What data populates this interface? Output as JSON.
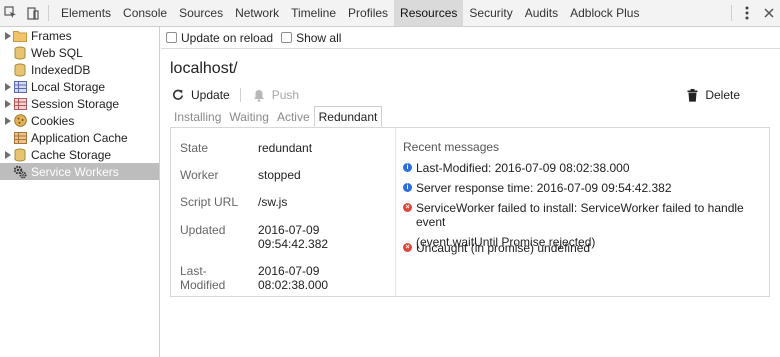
{
  "toolbar": {
    "tabs": [
      {
        "label": "Elements"
      },
      {
        "label": "Console"
      },
      {
        "label": "Sources"
      },
      {
        "label": "Network"
      },
      {
        "label": "Timeline"
      },
      {
        "label": "Profiles"
      },
      {
        "label": "Resources",
        "active": true
      },
      {
        "label": "Security"
      },
      {
        "label": "Audits"
      },
      {
        "label": "Adblock Plus"
      }
    ],
    "icons": [
      "inspect-cursor-icon",
      "device-mode-icon",
      "more-vertical-icon",
      "close-icon"
    ]
  },
  "sidebar": {
    "items": [
      {
        "label": "Frames",
        "icon": "folder-icon",
        "expandable": true
      },
      {
        "label": "Web SQL",
        "icon": "database-icon",
        "expandable": false
      },
      {
        "label": "IndexedDB",
        "icon": "database-icon",
        "expandable": false
      },
      {
        "label": "Local Storage",
        "icon": "table-icon",
        "expandable": true
      },
      {
        "label": "Session Storage",
        "icon": "table-icon",
        "expandable": true
      },
      {
        "label": "Cookies",
        "icon": "cookie-icon",
        "expandable": true
      },
      {
        "label": "Application Cache",
        "icon": "table-icon",
        "expandable": false
      },
      {
        "label": "Cache Storage",
        "icon": "database-icon",
        "expandable": true
      },
      {
        "label": "Service Workers",
        "icon": "gears-icon",
        "expandable": false,
        "selected": true
      }
    ]
  },
  "options": {
    "update_on_reload": "Update on reload",
    "show_all": "Show all"
  },
  "host": "localhost/",
  "actions": {
    "update": "Update",
    "push": "Push",
    "delete": "Delete"
  },
  "state_tabs": [
    {
      "label": "Installing"
    },
    {
      "label": "Waiting"
    },
    {
      "label": "Active"
    },
    {
      "label": "Redundant",
      "active": true
    }
  ],
  "fields": [
    {
      "key": "State",
      "value": "redundant"
    },
    {
      "key": "Worker",
      "value": "stopped"
    },
    {
      "key": "Script URL",
      "value": "/sw.js"
    },
    {
      "key": "Updated",
      "value": "2016-07-09",
      "value2": "09:54:42.382"
    },
    {
      "key": "Last-",
      "key2": "Modified",
      "value": "2016-07-09",
      "value2": "08:02:38.000"
    }
  ],
  "messages": {
    "title": "Recent messages",
    "items": [
      {
        "level": "info",
        "text": "Last-Modified: 2016-07-09 08:02:38.000"
      },
      {
        "level": "info",
        "text": "Server response time: 2016-07-09 09:54:42.382"
      },
      {
        "level": "error",
        "text": "ServiceWorker failed to install: ServiceWorker failed to handle event",
        "text2": "(event.waitUntil Promise rejected)"
      },
      {
        "level": "error",
        "text": "Uncaught (in promise) undefined"
      }
    ]
  },
  "colors": {
    "selected_sidebar": "#bdbdbd",
    "active_tab": "#dadada",
    "info": "#2a6fdb",
    "error": "#e0463c"
  }
}
